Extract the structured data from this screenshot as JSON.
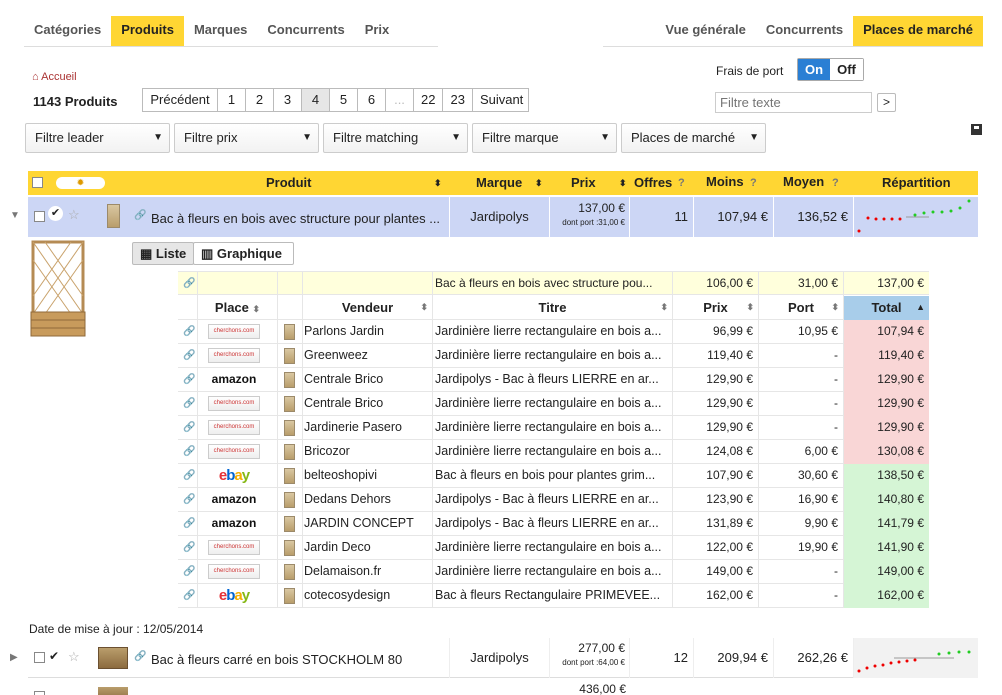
{
  "tabs_left": [
    {
      "label": "Catégories"
    },
    {
      "label": "Produits"
    },
    {
      "label": "Marques"
    },
    {
      "label": "Concurrents"
    },
    {
      "label": "Prix"
    }
  ],
  "tabs_right": [
    {
      "label": "Vue générale"
    },
    {
      "label": "Concurrents"
    },
    {
      "label": "Places de marché"
    }
  ],
  "breadcrumb": "Accueil",
  "count": "1143 Produits",
  "pager": {
    "prev": "Précédent",
    "pages": [
      "1",
      "2",
      "3",
      "4",
      "5",
      "6",
      "...",
      "22",
      "23"
    ],
    "next": "Suivant"
  },
  "frais": {
    "label": "Frais de port",
    "on": "On",
    "off": "Off"
  },
  "search": {
    "placeholder": "Filtre texte",
    "go": ">"
  },
  "filters": [
    "Filtre leader",
    "Filtre prix",
    "Filtre matching",
    "Filtre marque",
    "Places de marché"
  ],
  "header": {
    "produit": "Produit",
    "marque": "Marque",
    "prix": "Prix",
    "offres": "Offres",
    "moins": "Moins",
    "moyen": "Moyen",
    "repartition": "Répartition",
    "help": "?"
  },
  "product": {
    "name": "Bac à fleurs en bois avec structure pour plantes ...",
    "brand": "Jardipolys",
    "price": "137,00 €",
    "port": "dont port :31,00 €",
    "offers": "11",
    "min": "107,94 €",
    "avg": "136,52 €"
  },
  "views": {
    "list": "Liste",
    "chart": "Graphique"
  },
  "summary": {
    "title": "Bac à fleurs en bois avec structure pou...",
    "prix": "106,00 €",
    "port": "31,00 €",
    "total": "137,00 €"
  },
  "inner_header": {
    "place": "Place",
    "vendeur": "Vendeur",
    "titre": "Titre",
    "prix": "Prix",
    "port": "Port",
    "total": "Total"
  },
  "offers": [
    {
      "logo": "cherchons.com",
      "vendor": "Parlons Jardin",
      "title": "Jardinière lierre rectangulaire en bois a...",
      "price": "96,99 €",
      "port": "10,95 €",
      "total": "107,94 €",
      "status": "higher"
    },
    {
      "logo": "cherchons.com",
      "vendor": "Greenweez",
      "title": "Jardinière lierre rectangulaire en bois a...",
      "price": "119,40 €",
      "port": "-",
      "total": "119,40 €",
      "status": "higher"
    },
    {
      "logo": "amazon",
      "vendor": "Centrale Brico",
      "title": "Jardipolys - Bac à fleurs LIERRE en ar...",
      "price": "129,90 €",
      "port": "-",
      "total": "129,90 €",
      "status": "higher"
    },
    {
      "logo": "cherchons.com",
      "vendor": "Centrale Brico",
      "title": "Jardinière lierre rectangulaire en bois a...",
      "price": "129,90 €",
      "port": "-",
      "total": "129,90 €",
      "status": "higher"
    },
    {
      "logo": "cherchons.com",
      "vendor": "Jardinerie Pasero",
      "title": "Jardinière lierre rectangulaire en bois a...",
      "price": "129,90 €",
      "port": "-",
      "total": "129,90 €",
      "status": "higher"
    },
    {
      "logo": "cherchons.com",
      "vendor": "Bricozor",
      "title": "Jardinière lierre rectangulaire en bois a...",
      "price": "124,08 €",
      "port": "6,00 €",
      "total": "130,08 €",
      "status": "higher"
    },
    {
      "logo": "ebay",
      "vendor": "belteoshopivi",
      "title": "Bac à fleurs en bois pour plantes grim...",
      "price": "107,90 €",
      "port": "30,60 €",
      "total": "138,50 €",
      "status": "lower"
    },
    {
      "logo": "amazon",
      "vendor": "Dedans Dehors",
      "title": "Jardipolys - Bac à fleurs LIERRE en ar...",
      "price": "123,90 €",
      "port": "16,90 €",
      "total": "140,80 €",
      "status": "lower"
    },
    {
      "logo": "amazon",
      "vendor": "JARDIN CONCEPT",
      "title": "Jardipolys - Bac à fleurs LIERRE en ar...",
      "price": "131,89 €",
      "port": "9,90 €",
      "total": "141,79 €",
      "status": "lower"
    },
    {
      "logo": "cherchons.com",
      "vendor": "Jardin Deco",
      "title": "Jardinière lierre rectangulaire en bois a...",
      "price": "122,00 €",
      "port": "19,90 €",
      "total": "141,90 €",
      "status": "lower"
    },
    {
      "logo": "cherchons.com",
      "vendor": "Delamaison.fr",
      "title": "Jardinière lierre rectangulaire en bois a...",
      "price": "149,00 €",
      "port": "-",
      "total": "149,00 €",
      "status": "lower"
    },
    {
      "logo": "ebay",
      "vendor": "cotecosydesign",
      "title": "Bac à fleurs Rectangulaire PRIMEVEE...",
      "price": "162,00 €",
      "port": "-",
      "total": "162,00 €",
      "status": "lower"
    }
  ],
  "update": "Date de mise à jour : 12/05/2014",
  "product2": {
    "name": "Bac à fleurs carré en bois STOCKHOLM 80",
    "brand": "Jardipolys",
    "price": "277,00 €",
    "port": "dont port :64,00 €",
    "offers": "12",
    "min": "209,94 €",
    "avg": "262,26 €"
  },
  "product3": {
    "price": "436,00 €"
  },
  "colors": {
    "accent": "#ffd633",
    "selected": "#ccd6f5",
    "higher": "#f9d6d6",
    "lower": "#d5f5d5",
    "on": "#2a7fd4"
  }
}
